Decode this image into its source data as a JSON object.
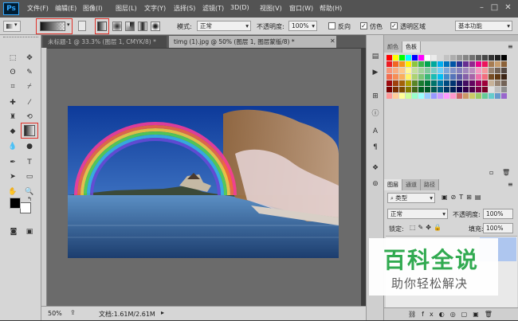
{
  "app": {
    "logo": "Ps"
  },
  "menu": [
    "文件(F)",
    "编辑(E)",
    "图像(I)",
    "图层(L)",
    "文字(Y)",
    "选择(S)",
    "滤镜(T)",
    "3D(D)",
    "视图(V)",
    "窗口(W)",
    "帮助(H)"
  ],
  "options": {
    "mode_label": "模式:",
    "mode_value": "正常",
    "opacity_label": "不透明度:",
    "opacity_value": "100%",
    "reverse_label": "反向",
    "dither_label": "仿色",
    "transparency_label": "透明区域",
    "workspace": "基本功能"
  },
  "tabs": [
    {
      "label": "未标题-1 @ 33.3% (图层 1, CMYK/8) *"
    },
    {
      "label": "timg (1).jpg @ 50% (图层 1, 图层蒙版/8) *"
    }
  ],
  "status": {
    "zoom": "50%",
    "doc": "文档:1.61M/2.61M"
  },
  "panels": {
    "color_tabs": [
      "颜色",
      "色板"
    ],
    "layer_tabs": [
      "图层",
      "通道",
      "路径"
    ],
    "filter_label": "类型",
    "blend_mode": "正常",
    "opacity_label": "不透明度:",
    "opacity_value": "100%",
    "lock_label": "锁定:",
    "fill_label": "填充:",
    "fill_value": "100%"
  },
  "watermark": {
    "title": "百科全说",
    "subtitle": "助你轻松解决"
  },
  "colors": {
    "menubar": "#535353",
    "panel": "#d6d6d6",
    "canvas_bg": "#6b6b6b",
    "highlight": "#e0322a"
  }
}
